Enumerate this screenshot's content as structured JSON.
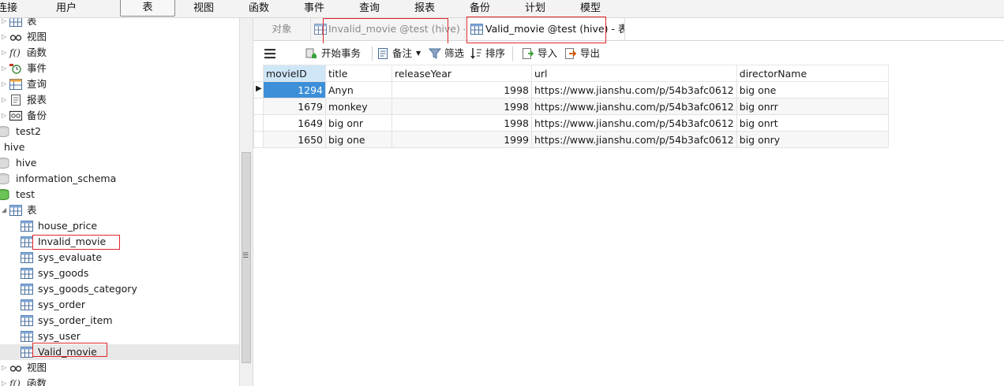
{
  "menu": [
    "连接",
    "用户",
    "表",
    "视图",
    "函数",
    "事件",
    "查询",
    "报表",
    "备份",
    "计划",
    "模型"
  ],
  "menu_active": "表",
  "sidebar": {
    "rows": [
      {
        "label": "表",
        "icon": "table-icon"
      },
      {
        "label": "视图",
        "icon": "view-icon"
      },
      {
        "label": "函数",
        "icon": "function-icon"
      },
      {
        "label": "事件",
        "icon": "event-icon"
      },
      {
        "label": "查询",
        "icon": "query-icon"
      },
      {
        "label": "报表",
        "icon": "report-icon"
      },
      {
        "label": "备份",
        "icon": "backup-icon"
      },
      {
        "label": "test2",
        "icon": "database-icon"
      },
      {
        "label": "hive",
        "icon": ""
      },
      {
        "label": "hive",
        "icon": "database-icon"
      },
      {
        "label": "information_schema",
        "icon": "database-icon"
      },
      {
        "label": "test",
        "icon": "database-open-icon"
      },
      {
        "label": "表",
        "icon": "table-icon"
      },
      {
        "label": "house_price",
        "icon": "table-icon"
      },
      {
        "label": "Invalid_movie",
        "icon": "table-icon"
      },
      {
        "label": "sys_evaluate",
        "icon": "table-icon"
      },
      {
        "label": "sys_goods",
        "icon": "table-icon"
      },
      {
        "label": "sys_goods_category",
        "icon": "table-icon"
      },
      {
        "label": "sys_order",
        "icon": "table-icon"
      },
      {
        "label": "sys_order_item",
        "icon": "table-icon"
      },
      {
        "label": "sys_user",
        "icon": "table-icon"
      },
      {
        "label": "Valid_movie",
        "icon": "table-icon"
      },
      {
        "label": "视图",
        "icon": "view-icon"
      },
      {
        "label": "函数",
        "icon": "function-icon"
      }
    ]
  },
  "tabs": {
    "objects": "对象",
    "tab1": "Invalid_movie @test (hive) - ...",
    "tab2": "Valid_movie @test (hive) - 表"
  },
  "toolbar": {
    "begin_transaction": "开始事务",
    "memo": "备注",
    "filter": "筛选",
    "sort": "排序",
    "import": "导入",
    "export": "导出"
  },
  "grid": {
    "columns": [
      "movieID",
      "title",
      "releaseYear",
      "url",
      "directorName"
    ],
    "rows": [
      [
        "1294",
        "Anyn",
        "1998",
        "https://www.jianshu.com/p/54b3afc0612",
        "big one"
      ],
      [
        "1679",
        "monkey",
        "1998",
        "https://www.jianshu.com/p/54b3afc0612",
        "big onrr"
      ],
      [
        "1649",
        "big onr",
        "1998",
        "https://www.jianshu.com/p/54b3afc0612",
        "big onrt"
      ],
      [
        "1650",
        "big one",
        "1999",
        "https://www.jianshu.com/p/54b3afc0612",
        "big onry"
      ]
    ]
  },
  "colors": {
    "highlight_box": "#e0262b",
    "selected_cell": "#3d8fd8",
    "selected_header": "#cfe6f7"
  }
}
